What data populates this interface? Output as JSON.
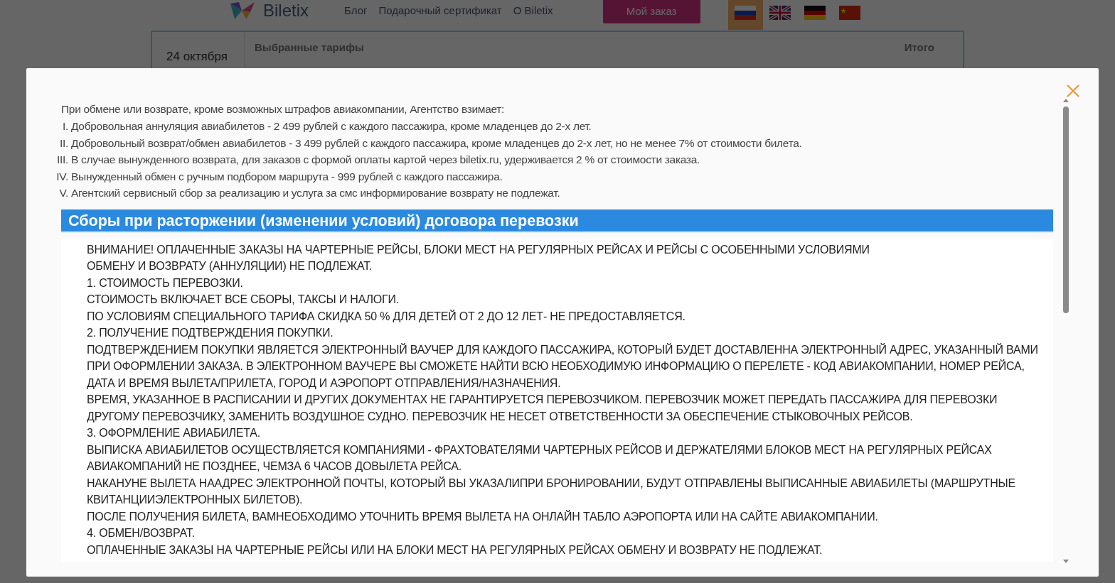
{
  "header": {
    "logo_text": "Biletix",
    "nav": [
      "Блог",
      "Подарочный сертификат",
      "О Biletix"
    ],
    "order_button": "Мой заказ",
    "languages": [
      {
        "kind": "ru",
        "selected": true
      },
      {
        "kind": "uk",
        "selected": false
      },
      {
        "kind": "de",
        "selected": false
      },
      {
        "kind": "cn",
        "selected": false
      }
    ]
  },
  "booking_card": {
    "date": "24 октября",
    "fares_label": "Выбранные тарифы",
    "total_label": "Итого"
  },
  "modal": {
    "intro": "При обмене или возврате, кроме возможных штрафов авиакомпании, Агентство взимает:",
    "fees": [
      {
        "numeral": "I.",
        "text": "Добровольная аннуляция авиабилетов - 2 499 рублей с каждого пассажира, кроме младенцев до 2-х лет."
      },
      {
        "numeral": "II.",
        "text": "Добровольный возврат/обмен авиабилетов - 3 499 рублей с каждого пассажира, кроме младенцев до 2-х лет, но не менее 7% от стоимости билета."
      },
      {
        "numeral": "III.",
        "text": "В случае вынужденного возврата, для заказов с формой оплаты картой через biletix.ru, удерживается 2 % от стоимости заказа."
      },
      {
        "numeral": "IV.",
        "text": "Вынужденный обмен с ручным подбором маршрута - 999 рублей с каждого пассажира."
      },
      {
        "numeral": "V.",
        "text": "Агентский сервисный сбор за реализацию и услуга за смс информирование возврату не подлежат."
      }
    ],
    "section_title": "Сборы при расторжении (изменении условий) договора перевозки",
    "terms": [
      "ВНИМАНИЕ! ОПЛАЧЕННЫЕ ЗАКАЗЫ НА ЧАРТЕРНЫЕ РЕЙСЫ, БЛОКИ МЕСТ НА РЕГУЛЯРНЫХ РЕЙСАХ И РЕЙСЫ С ОСОБЕННЫМИ УСЛОВИЯМИ",
      "ОБМЕНУ И ВОЗВРАТУ (АННУЛЯЦИИ) НЕ ПОДЛЕЖАТ.",
      "1. СТОИМОСТЬ ПЕРЕВОЗКИ.",
      "СТОИМОСТЬ ВКЛЮЧАЕТ ВСЕ СБОРЫ, ТАКСЫ И НАЛОГИ.",
      "ПО УСЛОВИЯМ СПЕЦИАЛЬНОГО ТАРИФА СКИДКА 50 % ДЛЯ ДЕТЕЙ ОТ 2 ДО 12 ЛЕТ- НЕ ПРЕДОСТАВЛЯЕТСЯ.",
      "2. ПОЛУЧЕНИЕ ПОДТВЕРЖДЕНИЯ ПОКУПКИ.",
      "ПОДТВЕРЖДЕНИЕМ ПОКУПКИ ЯВЛЯЕТСЯ ЭЛЕКТРОННЫЙ ВАУЧЕР ДЛЯ КАЖДОГО ПАССАЖИРА, КОТОРЫЙ БУДЕТ ДОСТАВЛЕННА ЭЛЕКТРОННЫЙ АДРЕС, УКАЗАННЫЙ ВАМИ",
      "ПРИ ОФОРМЛЕНИИ ЗАКАЗА. В ЭЛЕКТРОННОМ ВАУЧЕРЕ ВЫ СМОЖЕТЕ НАЙТИ ВСЮ НЕОБХОДИМУЮ ИНФОРМАЦИЮ О ПЕРЕЛЕТЕ - КОД АВИАКОМПАНИИ, НОМЕР РЕЙСА,",
      "ДАТА И ВРЕМЯ ВЫЛЕТА/ПРИЛЕТА, ГОРОД И АЭРОПОРТ ОТПРАВЛЕНИЯ/НАЗНАЧЕНИЯ.",
      "ВРЕМЯ, УКАЗАННОЕ В РАСПИСАНИИ И ДРУГИХ ДОКУМЕНТАХ НЕ ГАРАНТИРУЕТСЯ ПЕРЕВОЗЧИКОМ. ПЕРЕВОЗЧИК МОЖЕТ ПЕРЕДАТЬ ПАССАЖИРА ДЛЯ ПЕРЕВОЗКИ",
      "ДРУГОМУ ПЕРЕВОЗЧИКУ, ЗАМЕНИТЬ ВОЗДУШНОЕ СУДНО. ПЕРЕВОЗЧИК НЕ НЕСЕТ ОТВЕТСТВЕННОСТИ ЗА ОБЕСПЕЧЕНИЕ СТЫКОВОЧНЫХ РЕЙСОВ.",
      "3. ОФОРМЛЕНИЕ АВИАБИЛЕТА.",
      "ВЫПИСКА АВИАБИЛЕТОВ ОСУЩЕСТВЛЯЕТСЯ КОМПАНИЯМИ - ФРАХТОВАТЕЛЯМИ ЧАРТЕРНЫХ РЕЙСОВ И ДЕРЖАТЕЛЯМИ БЛОКОВ МЕСТ НА РЕГУЛЯРНЫХ РЕЙСАХ",
      "АВИАКОМПАНИЙ НЕ ПОЗДНЕЕ, ЧЕМЗА 6 ЧАСОВ ДОВЫЛЕТА РЕЙСА.",
      "НАКАНУНЕ ВЫЛЕТА НААДРЕС ЭЛЕКТРОННОЙ ПОЧТЫ, КОТОРЫЙ ВЫ УКАЗАЛИПРИ БРОНИРОВАНИИ, БУДУТ ОТПРАВЛЕНЫ ВЫПИСАННЫЕ АВИАБИЛЕТЫ (МАРШРУТНЫЕ",
      "КВИТАНЦИИЭЛЕКТРОННЫХ БИЛЕТОВ).",
      "ПОСЛЕ ПОЛУЧЕНИЯ БИЛЕТА, ВАМНЕОБХОДИМО УТОЧНИТЬ ВРЕМЯ ВЫЛЕТА НА ОНЛАЙН ТАБЛО АЭРОПОРТА ИЛИ НА САЙТЕ АВИАКОМПАНИИ.",
      "4. ОБМЕН/ВОЗВРАТ.",
      "ОПЛАЧЕННЫЕ ЗАКАЗЫ НА ЧАРТЕРНЫЕ РЕЙСЫ ИЛИ НА БЛОКИ МЕСТ НА РЕГУЛЯРНЫХ РЕЙСАХ ОБМЕНУ И ВОЗВРАТУ НЕ ПОДЛЕЖАТ."
    ]
  }
}
